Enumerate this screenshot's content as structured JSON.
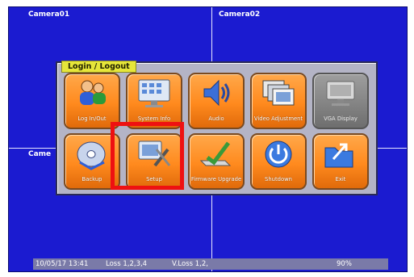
{
  "cameras": {
    "top_left": "Camera01",
    "top_right": "Camera02",
    "bottom_left_partial": "Came"
  },
  "menu": {
    "title": "Login / Logout",
    "tiles": [
      {
        "label": "Log In/Out",
        "icon": "login-users-icon",
        "enabled": true
      },
      {
        "label": "System Info",
        "icon": "system-info-monitor-icon",
        "enabled": true
      },
      {
        "label": "Audio",
        "icon": "speaker-icon",
        "enabled": true
      },
      {
        "label": "Video Adjustment",
        "icon": "video-adjustment-icon",
        "enabled": true
      },
      {
        "label": "VGA Display",
        "icon": "vga-display-icon",
        "enabled": false
      },
      {
        "label": "Backup",
        "icon": "backup-disc-icon",
        "enabled": true
      },
      {
        "label": "Setup",
        "icon": "setup-tools-icon",
        "enabled": true,
        "highlighted": true
      },
      {
        "label": "Firmware Upgrade",
        "icon": "firmware-upgrade-icon",
        "enabled": true
      },
      {
        "label": "Shutdown",
        "icon": "power-icon",
        "enabled": true
      },
      {
        "label": "Exit",
        "icon": "exit-folder-icon",
        "enabled": true
      }
    ]
  },
  "status_bar": {
    "datetime": "10/05/17 13:41",
    "loss": "Loss 1,2,3,4",
    "vloss": "V.Loss 1,2,",
    "disk": "90%"
  },
  "colors": {
    "screen_bg": "#1b1bd0",
    "tile_orange": "#ff8a1e",
    "highlight_red": "#ee1111",
    "title_yellow": "#e6e63a"
  }
}
